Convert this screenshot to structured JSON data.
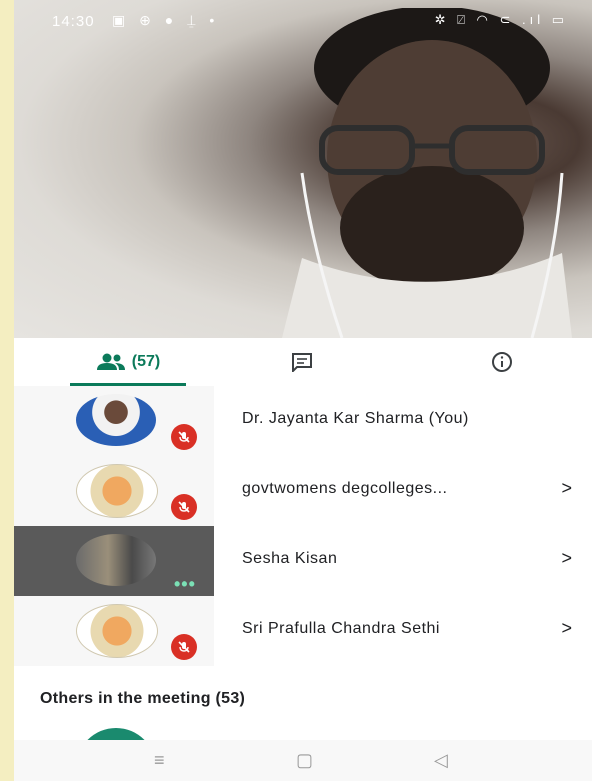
{
  "status_bar": {
    "time": "14:30",
    "left_icons": "▣ ⊕ ● ⍊ •",
    "right_icons": "✲ ⍁ ◠ ⊂ .ıl ▭"
  },
  "tabs": {
    "people_count": "(57)",
    "chat_icon": "chat-icon",
    "info_icon": "info-icon"
  },
  "participants": [
    {
      "name": "Dr. Jayanta Kar Sharma (You)",
      "muted": true,
      "chevron": ""
    },
    {
      "name": "govtwomens degcolleges...",
      "muted": true,
      "chevron": ">"
    },
    {
      "name": "Sesha Kisan",
      "muted": false,
      "chevron": ">"
    },
    {
      "name": "Sri Prafulla Chandra Sethi",
      "muted": true,
      "chevron": ">"
    }
  ],
  "others_heading": "Others in the meeting (53)",
  "nav_bar": {
    "menu": "≡",
    "home": "▢",
    "back": "◁"
  },
  "colors": {
    "accent": "#0b7a5a",
    "mute": "#d93025",
    "frame": "#f4eec1"
  }
}
